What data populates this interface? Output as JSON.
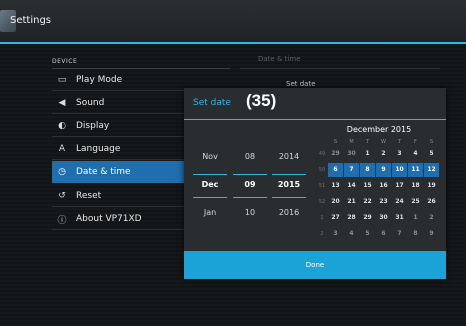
{
  "window": {
    "title": "Settings"
  },
  "sidebar": {
    "section": "DEVICE",
    "items": [
      {
        "label": "Play Mode",
        "icon": "play-mode-icon",
        "glyph": "▭"
      },
      {
        "label": "Sound",
        "icon": "speaker-icon",
        "glyph": "◀"
      },
      {
        "label": "Display",
        "icon": "display-icon",
        "glyph": "◐"
      },
      {
        "label": "Language",
        "icon": "language-icon",
        "glyph": "A"
      },
      {
        "label": "Date & time",
        "icon": "clock-icon",
        "glyph": "◷",
        "active": true
      },
      {
        "label": "Reset",
        "icon": "reset-icon",
        "glyph": "↺"
      },
      {
        "label": "About VP71XD",
        "icon": "info-icon",
        "glyph": "ⓘ"
      }
    ]
  },
  "background_panel": {
    "title": "Date & time",
    "subtitle": "Set date"
  },
  "dialog": {
    "title": "Set date",
    "badge": "(35)",
    "picker": {
      "month": [
        "Nov",
        "Dec",
        "Jan"
      ],
      "day": [
        "08",
        "09",
        "10"
      ],
      "year": [
        "2014",
        "2015",
        "2016"
      ],
      "selected_index": 1
    },
    "calendar": {
      "header": "December 2015",
      "weekdays": [
        "S",
        "M",
        "T",
        "W",
        "T",
        "F",
        "S"
      ],
      "weeks": [
        {
          "num": "49",
          "days": [
            "29",
            "30",
            "1",
            "2",
            "3",
            "4",
            "5"
          ]
        },
        {
          "num": "50",
          "days": [
            "6",
            "7",
            "8",
            "9",
            "10",
            "11",
            "12"
          ]
        },
        {
          "num": "51",
          "days": [
            "13",
            "14",
            "15",
            "16",
            "17",
            "18",
            "19"
          ]
        },
        {
          "num": "52",
          "days": [
            "20",
            "21",
            "22",
            "23",
            "24",
            "25",
            "26"
          ]
        },
        {
          "num": "1",
          "days": [
            "27",
            "28",
            "29",
            "30",
            "31",
            "1",
            "2"
          ]
        },
        {
          "num": "2",
          "days": [
            "3",
            "4",
            "5",
            "6",
            "7",
            "8",
            "9"
          ]
        }
      ],
      "highlight_week_index": 1,
      "accent": "#1f6fae"
    },
    "done_label": "Done"
  },
  "colors": {
    "accent": "#33b5e5",
    "selected": "#1f6fae",
    "button": "#1aa3d6"
  }
}
